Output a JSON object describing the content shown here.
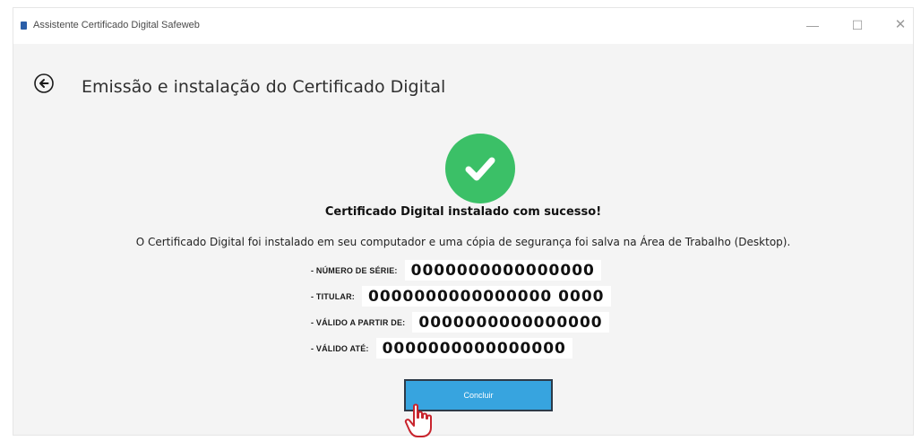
{
  "window": {
    "title": "Assistente Certificado Digital Safeweb",
    "controls": {
      "minimize": "—",
      "maximize": "☐",
      "close": "✕"
    }
  },
  "header": {
    "back_icon": "arrow-left-icon",
    "title": "Emissão e instalação do Certificado Digital"
  },
  "status": {
    "icon": "check-circle-icon",
    "color": "#3bc067",
    "title": "Certificado Digital instalado com sucesso!",
    "description": "O Certificado Digital foi instalado em seu computador e uma cópia de segurança foi salva na Área de Trabalho (Desktop)."
  },
  "details": [
    {
      "label": "- NÚMERO DE SÉRIE:",
      "value": "0000000000000000"
    },
    {
      "label": "- TITULAR:",
      "value": "0000000000000000 0000"
    },
    {
      "label": "- VÁLIDO A PARTIR DE:",
      "value": "0000000000000000"
    },
    {
      "label": "- VÁLIDO ATÉ:",
      "value": "0000000000000000"
    }
  ],
  "actions": {
    "conclude_label": "Concluir",
    "accent_color": "#37a4df"
  }
}
